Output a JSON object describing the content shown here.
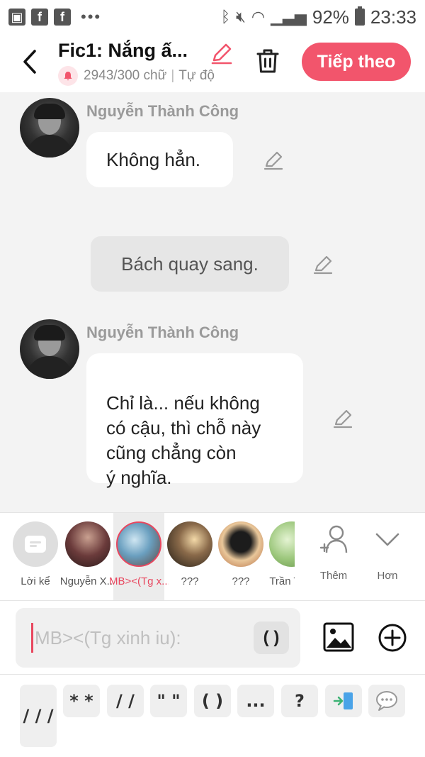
{
  "status_bar": {
    "battery": "92%",
    "time": "23:33",
    "icons": [
      "gallery-icon",
      "facebook-icon",
      "facebook-icon",
      "more-dots-icon",
      "bluetooth-icon",
      "mute-icon",
      "wifi-icon",
      "signal-icon",
      "battery-icon"
    ]
  },
  "header": {
    "title": "Fic1: Nắng ấ...",
    "word_count": "2943/300 chữ",
    "save_mode": "Tự độ",
    "next_label": "Tiếp theo",
    "accent_color": "#f2556c"
  },
  "chat": {
    "messages": [
      {
        "type": "character",
        "sender": "Nguyễn Thành Công",
        "text": "Không hẳn."
      },
      {
        "type": "narration",
        "text": "Bách quay sang."
      },
      {
        "type": "character",
        "sender": "Nguyễn Thành Công",
        "text": "Chỉ là... nếu không\ncó cậu, thì chỗ này\ncũng chẳng còn\ný nghĩa."
      }
    ]
  },
  "characters": {
    "items": [
      {
        "label": "Lời kể",
        "selected": false
      },
      {
        "label": "Nguyễn X...",
        "selected": false
      },
      {
        "label": "MB><(Tg x...",
        "selected": true
      },
      {
        "label": "???",
        "selected": false
      },
      {
        "label": "???",
        "selected": false
      },
      {
        "label": "Trần T",
        "selected": false
      }
    ],
    "add_label": "Thêm",
    "more_label": "Hơn"
  },
  "composer": {
    "placeholder": "MB><(Tg xinh iu):",
    "paren_label": "( )"
  },
  "symbols": [
    "/ / /",
    "* *",
    "/ /",
    "\" \"",
    "( )",
    "...",
    "?"
  ]
}
